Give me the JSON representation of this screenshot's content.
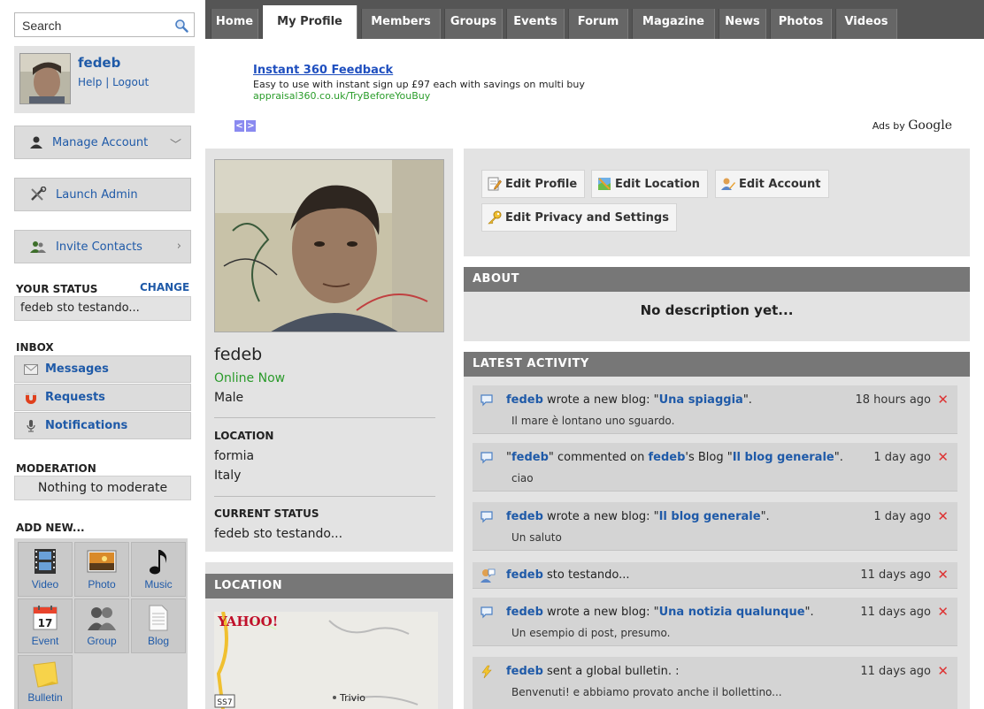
{
  "search": {
    "placeholder": "Search"
  },
  "user": {
    "name": "fedeb",
    "help": "Help",
    "sep": "|",
    "logout": "Logout"
  },
  "sidebar": {
    "manage_account": "Manage Account",
    "launch_admin": "Launch Admin",
    "invite_contacts": "Invite Contacts",
    "your_status_label": "YOUR STATUS",
    "change_label": "CHANGE",
    "status_text": "fedeb sto testando...",
    "inbox_label": "INBOX",
    "inbox_items": [
      "Messages",
      "Requests",
      "Notifications"
    ],
    "moderation_label": "MODERATION",
    "moderation_text": "Nothing to moderate",
    "add_new_label": "ADD NEW...",
    "add_items": [
      "Video",
      "Photo",
      "Music",
      "Event",
      "Group",
      "Blog",
      "Bulletin"
    ],
    "event_day": "17"
  },
  "nav": {
    "tabs": [
      "Home",
      "My Profile",
      "Members",
      "Groups",
      "Events",
      "Forum",
      "Magazine",
      "News",
      "Photos",
      "Videos"
    ],
    "active": "My Profile"
  },
  "ad": {
    "title": "Instant 360 Feedback",
    "desc": "Easy to use with instant sign up £97 each with savings on multi buy",
    "url": "appraisal360.co.uk/TryBeforeYouBuy",
    "ads_by": "Ads by",
    "google": "Google"
  },
  "profile": {
    "name": "fedeb",
    "online": "Online Now",
    "gender": "Male",
    "location_label": "LOCATION",
    "city": "formia",
    "country": "Italy",
    "current_status_label": "CURRENT STATUS",
    "current_status": "fedeb sto testando..."
  },
  "location_box": {
    "title": "LOCATION",
    "yahoo": "YAHOO!",
    "road": "SS7",
    "place": "Trivio"
  },
  "edit": {
    "profile": "Edit Profile",
    "location": "Edit Location",
    "account": "Edit Account",
    "privacy": "Edit Privacy and Settings"
  },
  "about": {
    "title": "ABOUT",
    "text": "No description yet..."
  },
  "activity": {
    "title": "LATEST ACTIVITY",
    "items": [
      {
        "user": "fedeb",
        "pre": "",
        "mid": " wrote a new blog: \"",
        "link": "Una spiaggia",
        "post": "\".",
        "sub": "Il mare è lontano uno sguardo.",
        "ago": "18 hours ago"
      },
      {
        "user": "fedeb",
        "pre": "\"",
        "mid": "\" commented on ",
        "user2": "fedeb",
        "mid2": "'s Blog \"",
        "link": "Il blog generale",
        "post": "\".",
        "sub": "ciao",
        "ago": "1 day ago"
      },
      {
        "user": "fedeb",
        "pre": "",
        "mid": " wrote a new blog: \"",
        "link": "Il blog generale",
        "post": "\".",
        "sub": "Un saluto",
        "ago": "1 day ago"
      },
      {
        "user": "fedeb",
        "pre": "",
        "mid": " sto testando...",
        "link": "",
        "post": "",
        "sub": "",
        "ago": "11 days ago"
      },
      {
        "user": "fedeb",
        "pre": "",
        "mid": " wrote a new blog: \"",
        "link": "Una notizia qualunque",
        "post": "\".",
        "sub": "Un esempio di post, presumo.",
        "ago": "11 days ago"
      },
      {
        "user": "fedeb",
        "pre": "",
        "mid": " sent a global bulletin. :",
        "link": "",
        "post": "",
        "sub": "Benvenuti! e abbiamo provato anche il bollettino...",
        "ago": "11 days ago"
      }
    ],
    "delete_glyph": "✕"
  }
}
